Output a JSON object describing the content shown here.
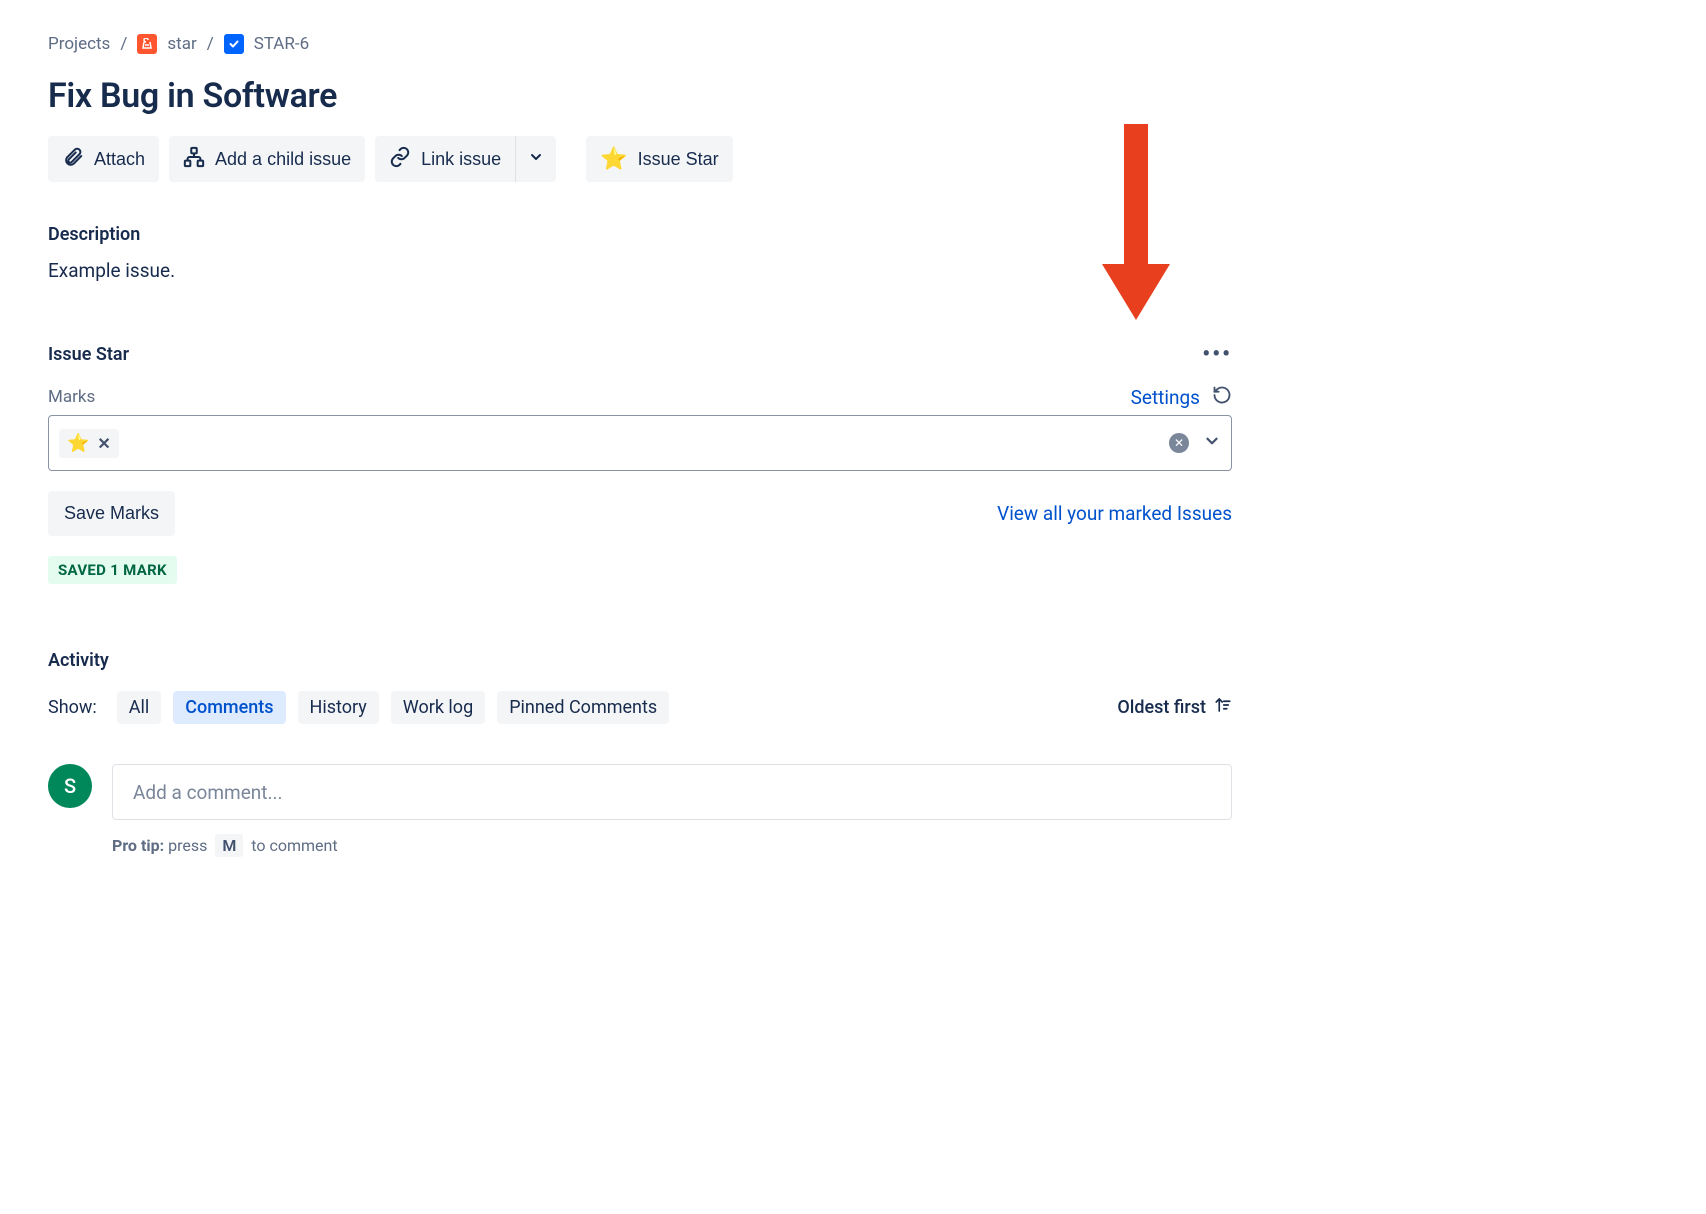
{
  "breadcrumbs": {
    "projects": "Projects",
    "project_name": "star",
    "issue_key": "STAR-6"
  },
  "title": "Fix Bug in Software",
  "actions": {
    "attach": "Attach",
    "add_child": "Add a child issue",
    "link_issue": "Link issue",
    "issue_star": "Issue Star"
  },
  "description": {
    "label": "Description",
    "text": "Example issue."
  },
  "issue_star": {
    "label": "Issue Star",
    "marks_label": "Marks",
    "settings": "Settings",
    "tag_icon": "⭐",
    "save_marks": "Save Marks",
    "view_all": "View all your marked Issues",
    "saved_badge": "SAVED 1 MARK"
  },
  "activity": {
    "label": "Activity",
    "show_label": "Show:",
    "filters": {
      "all": "All",
      "comments": "Comments",
      "history": "History",
      "worklog": "Work log",
      "pinned": "Pinned Comments"
    },
    "sort": "Oldest first",
    "avatar_initial": "S",
    "comment_placeholder": "Add a comment...",
    "pro_tip_label": "Pro tip:",
    "pro_tip_pre": "press",
    "pro_tip_key": "M",
    "pro_tip_post": "to comment"
  }
}
